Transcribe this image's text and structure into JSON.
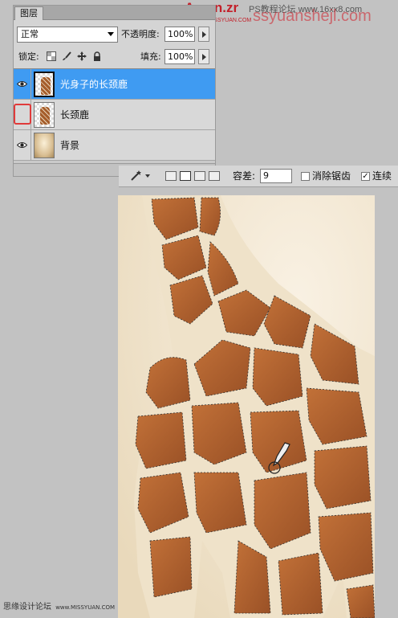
{
  "watermark": {
    "brand": "Aman.zr",
    "brand_sub": "WWW.MISSYUAN.COM",
    "site": "PS教程论坛 www.16xx8.com",
    "overlay": "ssyuanshejl.com"
  },
  "layers_panel": {
    "tab_label": "图层",
    "blend_mode": "正常",
    "opacity_label": "不透明度:",
    "opacity_value": "100%",
    "lock_label": "锁定:",
    "fill_label": "填充:",
    "fill_value": "100%",
    "lock_icons": [
      "transparency-lock-icon",
      "brush-icon",
      "move-icon",
      "padlock-icon"
    ],
    "layers": [
      {
        "name": "光身子的长颈鹿",
        "visible": true,
        "selected": true,
        "thumb": "checker"
      },
      {
        "name": "长颈鹿",
        "visible": false,
        "selected": false,
        "thumb": "checker"
      },
      {
        "name": "背景",
        "visible": true,
        "selected": false,
        "thumb": "background"
      }
    ]
  },
  "options_bar": {
    "tool_icon": "magic-wand-icon",
    "tolerance_label": "容差:",
    "tolerance_value": "9",
    "antialias_label": "消除锯齿",
    "antialias_checked": false,
    "contiguous_label": "连续",
    "contiguous_checked": true
  },
  "colors": {
    "selected_layer": "#3f9bf2",
    "highlight_box": "#e03a3a",
    "giraffe_brown": "#b6642f",
    "giraffe_light": "#efe2c9"
  },
  "footer": {
    "credit": "思缘设计论坛",
    "credit_url": "www.MISSYUAN.COM"
  }
}
